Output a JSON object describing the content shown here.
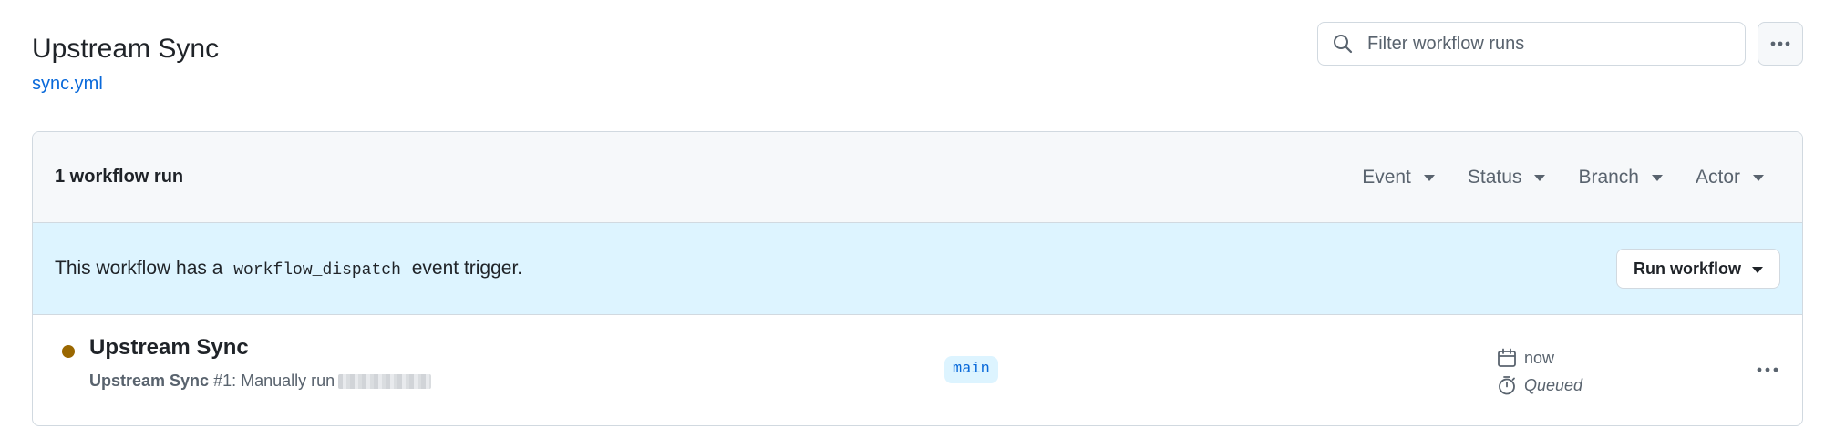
{
  "header": {
    "title": "Upstream Sync",
    "file_link": "sync.yml",
    "search_placeholder": "Filter workflow runs"
  },
  "box": {
    "runs_count": "1 workflow run",
    "filters": [
      {
        "label": "Event"
      },
      {
        "label": "Status"
      },
      {
        "label": "Branch"
      },
      {
        "label": "Actor"
      }
    ],
    "banner": {
      "prefix": "This workflow has a",
      "code": "workflow_dispatch",
      "suffix": "event trigger.",
      "button_label": "Run workflow"
    },
    "runs": [
      {
        "title": "Upstream Sync",
        "workflow_name": "Upstream Sync",
        "meta": "#1: Manually run",
        "branch": "main",
        "started": "now",
        "status": "Queued",
        "status_color": "#9a6700"
      }
    ]
  },
  "icons": {
    "search": "search-icon",
    "kebab": "kebab-horizontal-icon",
    "calendar": "calendar-icon",
    "stopwatch": "stopwatch-icon",
    "caret": "triangle-down-icon"
  },
  "colors": {
    "accent": "#0969da",
    "banner_bg": "#ddf4ff",
    "header_bg": "#f6f8fa",
    "border": "#d1d9e0",
    "queued": "#9a6700"
  }
}
